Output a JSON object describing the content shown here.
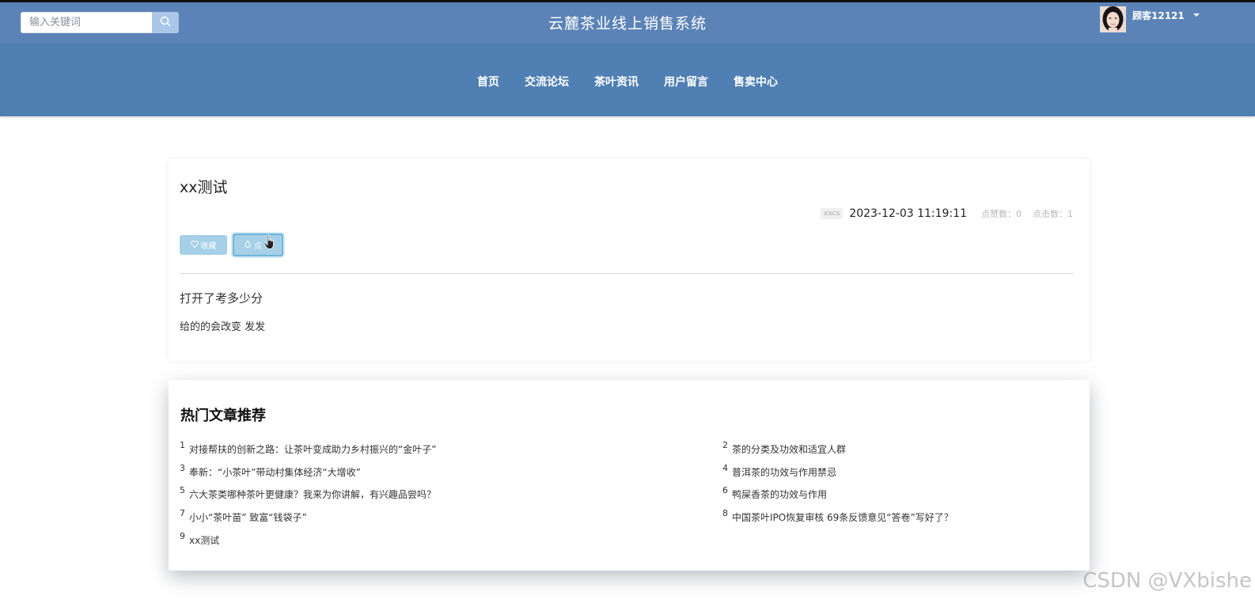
{
  "header": {
    "search_placeholder": "输入关键词",
    "site_title": "云麓茶业线上销售系统",
    "user_name": "顾客12121"
  },
  "nav": {
    "items": [
      "首页",
      "交流论坛",
      "茶叶资讯",
      "用户留言",
      "售卖中心"
    ]
  },
  "article": {
    "title": "xx测试",
    "author": "xxcs",
    "time": "2023-12-03 11:19:11",
    "likes": "点赞数：0",
    "clicks": "点击数：1",
    "collect_label": "收藏",
    "like_label": "点",
    "content_line_1": "打开了考多少分",
    "content_line_2": "给的的会改变 发发"
  },
  "hot": {
    "title": "热门文章推荐",
    "items": [
      {
        "num": "1",
        "text": "对接帮扶的创新之路：让茶叶变成助力乡村振兴的“金叶子”"
      },
      {
        "num": "2",
        "text": "茶的分类及功效和适宜人群"
      },
      {
        "num": "3",
        "text": "奉新：“小茶叶”带动村集体经济“大增收”"
      },
      {
        "num": "4",
        "text": "普洱茶的功效与作用禁忌"
      },
      {
        "num": "5",
        "text": "六大茶类哪种茶叶更健康？我来为你讲解，有兴趣品尝吗？"
      },
      {
        "num": "6",
        "text": "鸭屎香茶的功效与作用"
      },
      {
        "num": "7",
        "text": "小小“茶叶苗” 致富“钱袋子”"
      },
      {
        "num": "8",
        "text": "中国茶叶IPO恢复审核 69条反馈意见“答卷”写好了？"
      },
      {
        "num": "9",
        "text": "xx测试"
      }
    ]
  },
  "watermark": "CSDN @VXbishe",
  "colors": {
    "topbar": "#5b83b7",
    "navbar": "#4f7fb3",
    "button": "#a6cfe8"
  }
}
